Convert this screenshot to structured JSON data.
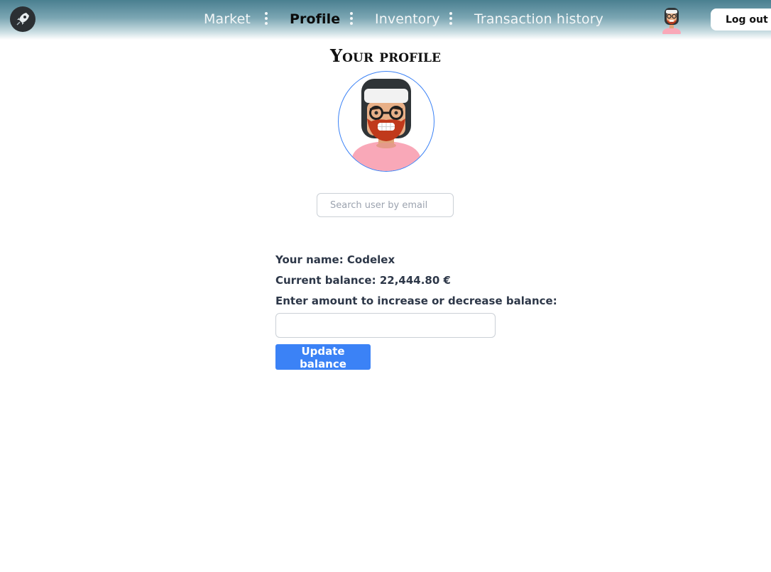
{
  "nav": {
    "links": [
      {
        "label": "Market",
        "active": false
      },
      {
        "label": "Profile",
        "active": true
      },
      {
        "label": "Inventory",
        "active": false
      },
      {
        "label": "Transaction history",
        "active": false
      }
    ],
    "logout_label": "Log out",
    "logo_icon": "rocket-icon",
    "avatar_icon": "user-avatar"
  },
  "profile": {
    "title": "Your profile",
    "search_placeholder": "Search user by email",
    "name_line": "Your name: Codelex",
    "balance_line": "Current balance: 22,444.80 €",
    "amount_label": "Enter amount to increase or decrease balance:",
    "amount_value": "",
    "update_label": "Update balance"
  },
  "colors": {
    "accent": "#3b82f6",
    "nav_gradient_top": "#4a7f90"
  }
}
